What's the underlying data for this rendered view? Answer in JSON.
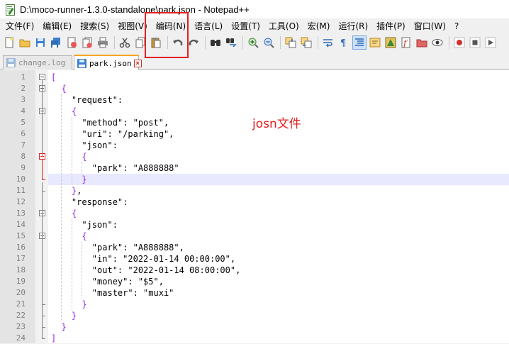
{
  "window": {
    "title": "D:\\moco-runner-1.3.0-standalone\\park.json - Notepad++"
  },
  "menu": [
    {
      "label": "文件(F)"
    },
    {
      "label": "编辑(E)"
    },
    {
      "label": "搜索(S)"
    },
    {
      "label": "视图(V)"
    },
    {
      "label": "编码(N)"
    },
    {
      "label": "语言(L)"
    },
    {
      "label": "设置(T)"
    },
    {
      "label": "工具(O)"
    },
    {
      "label": "宏(M)"
    },
    {
      "label": "运行(R)"
    },
    {
      "label": "插件(P)"
    },
    {
      "label": "窗口(W)"
    },
    {
      "label": "?"
    }
  ],
  "tabs": [
    {
      "label": "change.log",
      "active": false
    },
    {
      "label": "park.json",
      "active": true
    }
  ],
  "editor": {
    "lines": [
      {
        "n": "1",
        "text": "["
      },
      {
        "n": "2",
        "text": "  {"
      },
      {
        "n": "3",
        "text": "    \"request\":"
      },
      {
        "n": "4",
        "text": "    {"
      },
      {
        "n": "5",
        "text": "      \"method\": \"post\","
      },
      {
        "n": "6",
        "text": "      \"uri\": \"/parking\","
      },
      {
        "n": "7",
        "text": "      \"json\":"
      },
      {
        "n": "8",
        "text": "      {"
      },
      {
        "n": "9",
        "text": "        \"park\": \"A888888\""
      },
      {
        "n": "10",
        "text": "      }"
      },
      {
        "n": "11",
        "text": "    },"
      },
      {
        "n": "12",
        "text": "    \"response\":"
      },
      {
        "n": "13",
        "text": "    {"
      },
      {
        "n": "14",
        "text": "      \"json\":"
      },
      {
        "n": "15",
        "text": "      {"
      },
      {
        "n": "16",
        "text": "        \"park\": \"A888888\","
      },
      {
        "n": "17",
        "text": "        \"in\": \"2022-01-14 00:00:00\","
      },
      {
        "n": "18",
        "text": "        \"out\": \"2022-01-14 08:00:00\","
      },
      {
        "n": "19",
        "text": "        \"money\": \"$5\","
      },
      {
        "n": "20",
        "text": "        \"master\": \"muxi\""
      },
      {
        "n": "21",
        "text": "      }"
      },
      {
        "n": "22",
        "text": "    }"
      },
      {
        "n": "23",
        "text": "  }"
      },
      {
        "n": "24",
        "text": "]"
      }
    ],
    "current_line": "10"
  },
  "annotation": {
    "text": "josn文件",
    "color": "#e32020"
  },
  "colors": {
    "brace": "#8a2be2",
    "highlight_box": "#e32020",
    "current_line_bg": "#e8e8ff",
    "tab_accent": "#f5a623"
  },
  "toolbar_icons": [
    "new-file-icon",
    "open-file-icon",
    "save-icon",
    "save-all-icon",
    "close-icon",
    "close-all-icon",
    "print-icon",
    "cut-icon",
    "copy-icon",
    "paste-icon",
    "undo-icon",
    "redo-icon",
    "find-icon",
    "replace-icon",
    "zoom-in-icon",
    "zoom-out-icon",
    "sync-vertical-icon",
    "sync-horizontal-icon",
    "word-wrap-icon",
    "show-all-chars-icon",
    "indent-guide-icon",
    "udl-icon",
    "doc-map-icon",
    "function-list-icon",
    "folder-workspace-icon",
    "monitor-icon",
    "record-macro-icon",
    "stop-macro-icon",
    "play-macro-icon"
  ]
}
